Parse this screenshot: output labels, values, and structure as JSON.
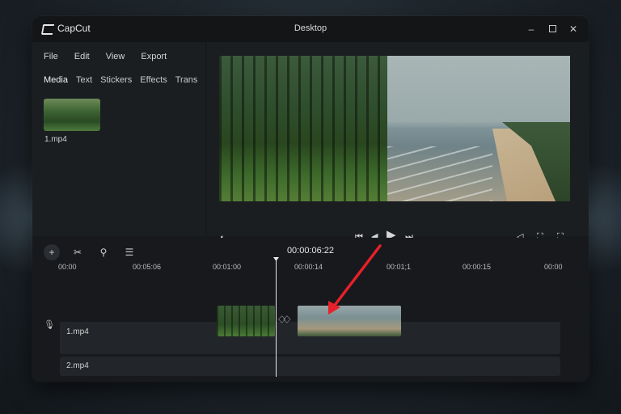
{
  "window": {
    "app_name": "CapCut",
    "title": "Desktop",
    "minimize": "–",
    "close": "✕"
  },
  "menu": [
    "File",
    "Edit",
    "View",
    "Export"
  ],
  "tabs": [
    "Media",
    "Text",
    "Stickers",
    "Effects",
    "Trans"
  ],
  "media": {
    "item_label": "1.mp4"
  },
  "preview": {
    "prev": "⏮",
    "step_back": "◀",
    "play": "▶",
    "next": "⏭"
  },
  "timeline": {
    "timecode": "00:00:06:22",
    "ticks": [
      "00:00",
      "00:05:06",
      "00:01:00",
      "00:00:14",
      "00:01;1",
      "00:00:15",
      "00:00"
    ],
    "tracks": [
      "1.mp4",
      "2.mp4"
    ]
  },
  "toolbar": {
    "add": "+",
    "split": "✂"
  },
  "colors": {
    "window_bg": "#17191c",
    "panel_bg": "#1b1e21",
    "arrow": "#e8202a"
  }
}
